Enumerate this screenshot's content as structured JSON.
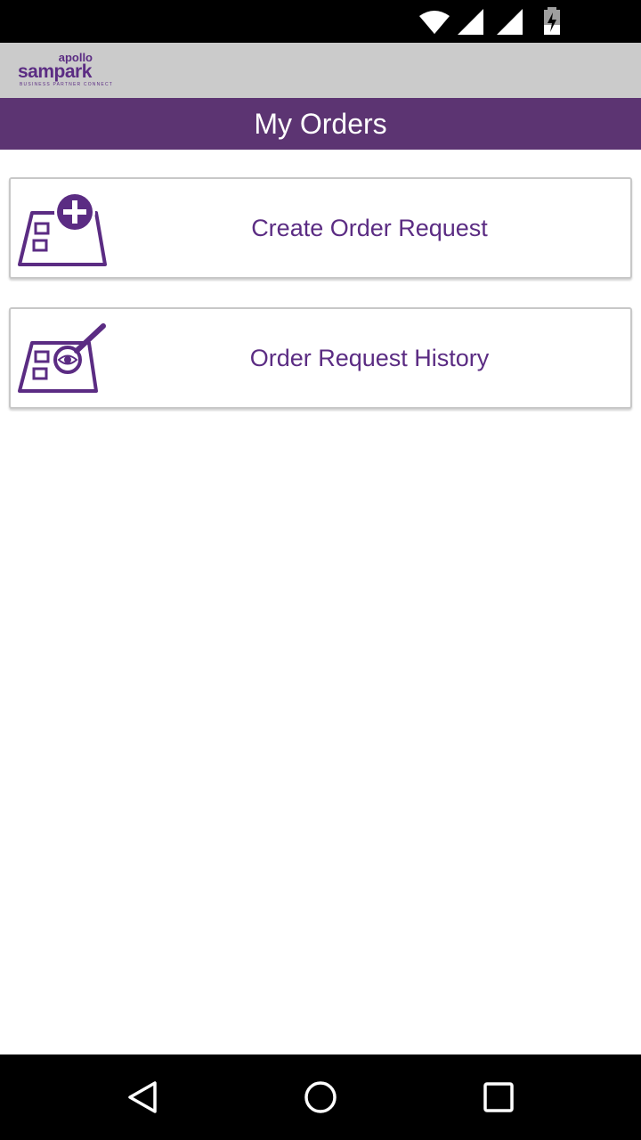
{
  "status_bar": {
    "icons": [
      "wifi-icon",
      "signal-icon",
      "signal-icon",
      "battery-charging-icon"
    ]
  },
  "brand": {
    "logo_top": "apollo",
    "logo_main": "sampark",
    "logo_tagline": "BUSINESS PARTNER CONNECT"
  },
  "header": {
    "title": "My Orders"
  },
  "menu": {
    "items": [
      {
        "label": "Create Order Request",
        "icon": "create-order-icon"
      },
      {
        "label": "Order Request History",
        "icon": "order-history-icon"
      }
    ]
  },
  "nav_bar": {
    "icons": [
      "back-icon",
      "home-icon",
      "recents-icon"
    ]
  },
  "colors": {
    "accent": "#5c3472",
    "text_accent": "#5b2c83",
    "brand_bar": "#cbcbcb"
  }
}
